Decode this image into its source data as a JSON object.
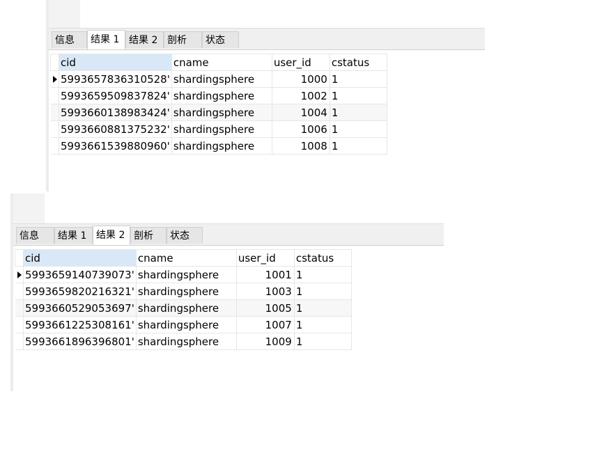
{
  "tabs": [
    "信息",
    "结果 1",
    "结果 2",
    "剖析",
    "状态"
  ],
  "columns": [
    "cid",
    "cname",
    "user_id",
    "cstatus"
  ],
  "panel1": {
    "active_tab": 1,
    "rows": [
      {
        "cid": "'5993657836310528",
        "cname": "shardingsphere",
        "user_id": "1000",
        "cstatus": "1"
      },
      {
        "cid": "'5993659509837824",
        "cname": "shardingsphere",
        "user_id": "1002",
        "cstatus": "1"
      },
      {
        "cid": "'5993660138983424",
        "cname": "shardingsphere",
        "user_id": "1004",
        "cstatus": "1"
      },
      {
        "cid": "'5993660881375232",
        "cname": "shardingsphere",
        "user_id": "1006",
        "cstatus": "1"
      },
      {
        "cid": "'5993661539880960",
        "cname": "shardingsphere",
        "user_id": "1008",
        "cstatus": "1"
      }
    ]
  },
  "panel2": {
    "active_tab": 2,
    "rows": [
      {
        "cid": "'5993659140739073",
        "cname": "shardingsphere",
        "user_id": "1001",
        "cstatus": "1"
      },
      {
        "cid": "'5993659820216321",
        "cname": "shardingsphere",
        "user_id": "1003",
        "cstatus": "1"
      },
      {
        "cid": "'5993660529053697",
        "cname": "shardingsphere",
        "user_id": "1005",
        "cstatus": "1"
      },
      {
        "cid": "'5993661225308161",
        "cname": "shardingsphere",
        "user_id": "1007",
        "cstatus": "1"
      },
      {
        "cid": "'5993661896396801",
        "cname": "shardingsphere",
        "user_id": "1009",
        "cstatus": "1"
      }
    ]
  },
  "colors": {
    "header_selected": "#d9e8f7",
    "tabbar_bg": "#f0f0f0"
  },
  "icons": {
    "row_pointer": "current-row-arrow-icon"
  }
}
